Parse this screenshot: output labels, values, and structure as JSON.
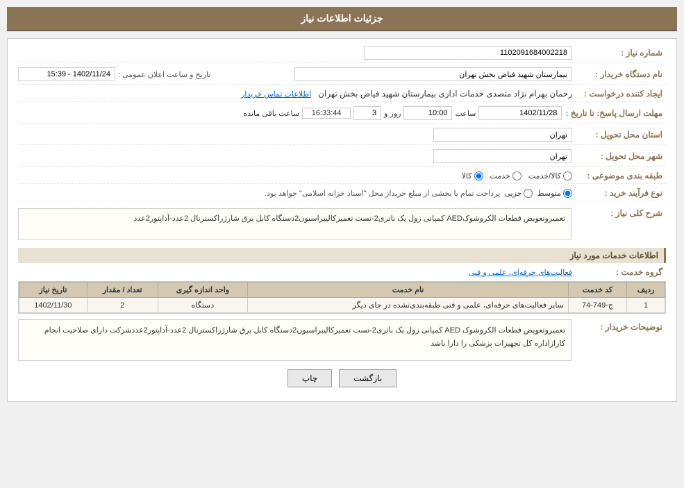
{
  "page": {
    "title": "جزئیات اطلاعات نیاز"
  },
  "header": {
    "label": "جزئیات اطلاعات نیاز"
  },
  "fields": {
    "need_number_label": "شماره نیاز :",
    "need_number_value": "1102091684002218",
    "buyer_name_label": "نام دستگاه خریدار :",
    "buyer_name_value": "بیمارستان شهید فیاض بخش تهران",
    "creator_label": "ایجاد کننده درخواست :",
    "creator_value": "رحمان بهرام نژاد متصدی خدمات اداری بیمارستان شهید فیاض بخش تهران",
    "creator_link": "اطلاعات تماس خریدار",
    "announce_datetime_label": "تاریخ و ساعت اعلان عمومی :",
    "announce_datetime_value": "1402/11/24 - 15:39",
    "response_deadline_label": "مهلت ارسال پاسخ: تا تاریخ :",
    "response_date": "1402/11/28",
    "response_time_label": "ساعت",
    "response_time": "10:00",
    "response_days_label": "روز و",
    "response_days": "3",
    "remaining_label": "ساعت باقی مانده",
    "remaining_time": "16:33:44",
    "province_label": "استان محل تحویل :",
    "province_value": "تهران",
    "city_label": "شهر محل تحویل :",
    "city_value": "تهران",
    "category_label": "طبقه بندی موضوعی :",
    "category_options": [
      "کالا",
      "خدمت",
      "کالا/خدمت"
    ],
    "category_selected": "کالا",
    "purchase_type_label": "نوع فرآیند خرید :",
    "purchase_type_options": [
      "جزیی",
      "متوسط"
    ],
    "purchase_type_selected": "متوسط",
    "purchase_type_note": "پرداخت تمام یا بخشی از مبلغ خریداز محل \"اسناد خزانه اسلامی\" خواهد بود.",
    "need_description_label": "شرح کلی نیاز :",
    "need_description_value": "تعمیروتعویض قطعات الکروشوکAED کمپانی زول یک باتری2-تست تعمیرکالیبراسیون2دستگاه کابل برق شارژراکسترنال  2عدد-آداپتور2عدد"
  },
  "service_info": {
    "section_title": "اطلاعات خدمات مورد نیاز",
    "service_group_label": "گروه خدمت :",
    "service_group_value": "فعالیت‌های حرفه‌ای، علمی و فنی"
  },
  "table": {
    "columns": [
      "ردیف",
      "کد خدمت",
      "نام خدمت",
      "واحد اندازه گیری",
      "تعداد / مقدار",
      "تاریخ نیاز"
    ],
    "rows": [
      {
        "row_num": "1",
        "service_code": "ج-749-74",
        "service_name": "سایر فعالیت‌های حرفه‌ای، علمی و فنی طبقه‌بندی‌نشده در جای دیگر",
        "unit": "دستگاه",
        "quantity": "2",
        "date": "1402/11/30"
      }
    ]
  },
  "buyer_comment": {
    "label": "توضیحات خریدار :",
    "value": "تعمیروتعویض قطعات الکروشوک AED کمپانی زول یک باتری2-تست تعمیرکالیبراسیون2دستگاه کابل برق شارژراکسترنال 2عدد-آداپتور2عددشرکت دارای صلاحیت انجام کارازاداره کل تجهیزات پزشکی را دارا باشد"
  },
  "buttons": {
    "print_label": "چاپ",
    "back_label": "بازگشت"
  }
}
